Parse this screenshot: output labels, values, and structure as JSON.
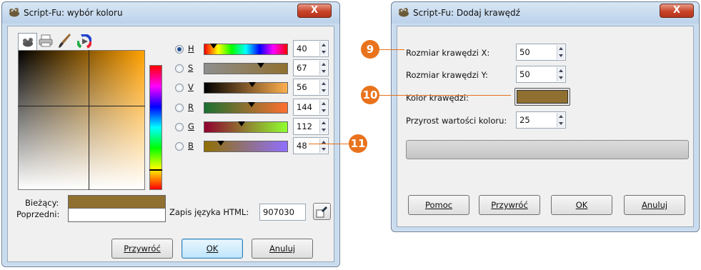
{
  "left_window": {
    "title": "Script-Fu: wybór koloru",
    "close_label": "X",
    "channels": [
      {
        "key": "H",
        "value": "40",
        "selected": true
      },
      {
        "key": "S",
        "value": "67",
        "selected": false
      },
      {
        "key": "V",
        "value": "56",
        "selected": false
      },
      {
        "key": "R",
        "value": "144",
        "selected": false
      },
      {
        "key": "G",
        "value": "112",
        "selected": false
      },
      {
        "key": "B",
        "value": "48",
        "selected": false
      }
    ],
    "current_label": "Bieżący:",
    "previous_label": "Poprzedni:",
    "html_label": "Zapis języka HTML:",
    "html_value": "907030",
    "current_color": "#907030",
    "buttons": {
      "reset": "Przywróć",
      "ok": "OK",
      "cancel": "Anuluj"
    }
  },
  "right_window": {
    "title": "Script-Fu: Dodaj krawędź",
    "close_label": "X",
    "fields": {
      "size_x_label": "Rozmiar krawędzi X:",
      "size_x_value": "50",
      "size_y_label": "Rozmiar krawędzi Y:",
      "size_y_value": "50",
      "color_label": "Kolor krawędzi:",
      "delta_label": "Przyrost wartości koloru:",
      "delta_value": "25"
    },
    "buttons": {
      "help": "Pomoc",
      "reset": "Przywróć",
      "ok": "OK",
      "cancel": "Anuluj"
    }
  },
  "callouts": [
    "9",
    "10",
    "11"
  ],
  "colors": {
    "accent": "#e8731c",
    "border_color": "#907030"
  }
}
